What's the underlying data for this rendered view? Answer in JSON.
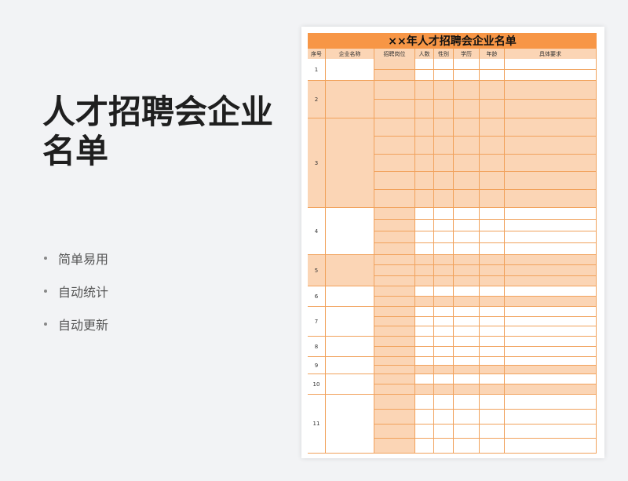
{
  "title": "人才招聘会企业名单",
  "features": [
    "简单易用",
    "自动统计",
    "自动更新"
  ],
  "sheet": {
    "banner": "××年人才招聘会企业名单",
    "headers": [
      "序号",
      "企业名称",
      "招聘岗位",
      "人数",
      "性别",
      "学历",
      "年龄",
      "具体要求"
    ],
    "row_numbers": [
      "1",
      "2",
      "3",
      "4",
      "5",
      "6",
      "7",
      "8",
      "9",
      "10",
      "11"
    ]
  },
  "colors": {
    "accent": "#f79646",
    "fill": "#fbd5b5",
    "border": "#f1a25c"
  }
}
